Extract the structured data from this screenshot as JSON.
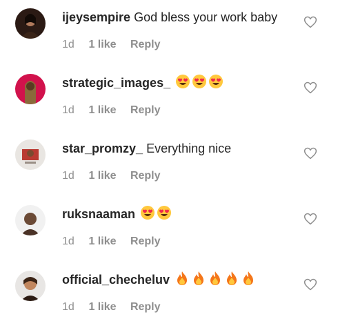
{
  "comments": [
    {
      "username": "ijeysempire",
      "text": "God bless your work baby",
      "emojis": [],
      "time": "1d",
      "likes": "1 like",
      "reply": "Reply",
      "avatar_colors": [
        "#2b1a14",
        "#b07a5c"
      ]
    },
    {
      "username": "strategic_images_",
      "text": "",
      "emojis": [
        "heart-eyes-emoji",
        "heart-eyes-emoji",
        "heart-eyes-emoji"
      ],
      "time": "1d",
      "likes": "1 like",
      "reply": "Reply",
      "avatar_colors": [
        "#d1124c",
        "#8a6a3a"
      ]
    },
    {
      "username": "star_promzy_",
      "text": "Everything nice",
      "emojis": [],
      "time": "1d",
      "likes": "1 like",
      "reply": "Reply",
      "avatar_colors": [
        "#e9e6e2",
        "#b93a32"
      ]
    },
    {
      "username": "ruksnaaman",
      "text": "",
      "emojis": [
        "heart-eyes-emoji",
        "heart-eyes-emoji"
      ],
      "time": "1d",
      "likes": "1 like",
      "reply": "Reply",
      "avatar_colors": [
        "#f1f1f1",
        "#6b4a36"
      ]
    },
    {
      "username": "official_checheluv",
      "text": "",
      "emojis": [
        "fire-emoji",
        "fire-emoji",
        "fire-emoji",
        "fire-emoji",
        "fire-emoji"
      ],
      "time": "1d",
      "likes": "1 like",
      "reply": "Reply",
      "avatar_colors": [
        "#e8e6e4",
        "#c2875f"
      ]
    }
  ]
}
